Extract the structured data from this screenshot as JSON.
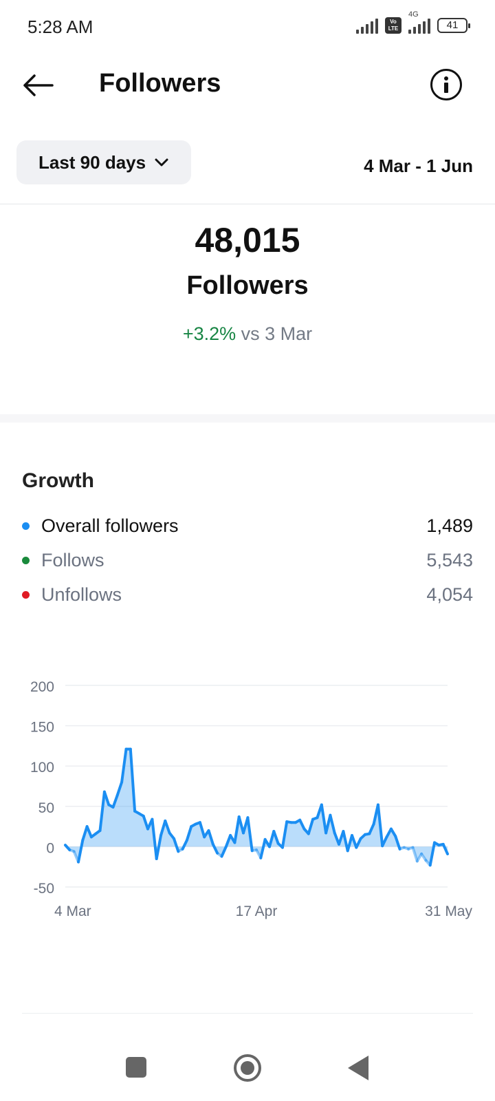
{
  "status_bar": {
    "time": "5:28 AM",
    "network": "4G",
    "volte": "Vo LTE",
    "battery": "41"
  },
  "header": {
    "title": "Followers",
    "back_icon": "arrow-left-icon",
    "info_icon": "info-icon"
  },
  "range": {
    "selected": "Last 90 days",
    "dates": "4 Mar - 1 Jun"
  },
  "summary": {
    "count": "48,015",
    "label": "Followers",
    "change": "+3.2%",
    "compare": "vs 3 Mar"
  },
  "growth": {
    "title": "Growth",
    "items": [
      {
        "label": "Overall followers",
        "value": "1,489",
        "color": "#1b8ef2",
        "text_color": "#111111"
      },
      {
        "label": "Follows",
        "value": "5,543",
        "color": "#1a8a3c",
        "text_color": "#6b7280"
      },
      {
        "label": "Unfollows",
        "value": "4,054",
        "color": "#e01b24",
        "text_color": "#6b7280"
      }
    ]
  },
  "colors": {
    "accent": "#1b8ef2",
    "positive": "#188544",
    "grid": "#eceef1"
  },
  "chart_data": {
    "type": "area",
    "series": [
      {
        "name": "Overall followers",
        "values": [
          2,
          -4,
          -6,
          -19,
          8,
          25,
          12,
          16,
          20,
          68,
          52,
          49,
          64,
          80,
          121,
          121,
          44,
          41,
          38,
          22,
          34,
          -15,
          14,
          32,
          17,
          10,
          -6,
          -3,
          8,
          25,
          28,
          30,
          12,
          20,
          3,
          -8,
          -12,
          0,
          14,
          5,
          37,
          17,
          36,
          -5,
          -4,
          -14,
          9,
          0,
          19,
          4,
          -1,
          31,
          30,
          30,
          33,
          22,
          16,
          34,
          36,
          52,
          17,
          39,
          17,
          3,
          19,
          -5,
          14,
          -1,
          10,
          15,
          16,
          28,
          52,
          1,
          12,
          22,
          13,
          -3,
          -1,
          -3,
          -1,
          -18,
          -9,
          -17,
          -23,
          5,
          2,
          3,
          -9
        ]
      }
    ],
    "x_tick_labels": [
      "4 Mar",
      "17 Apr",
      "31 May"
    ],
    "x_tick_index": [
      0,
      44,
      88
    ],
    "y_ticks": [
      200,
      150,
      100,
      50,
      0,
      -50
    ],
    "ylim": [
      -50,
      200
    ],
    "grid": true
  }
}
